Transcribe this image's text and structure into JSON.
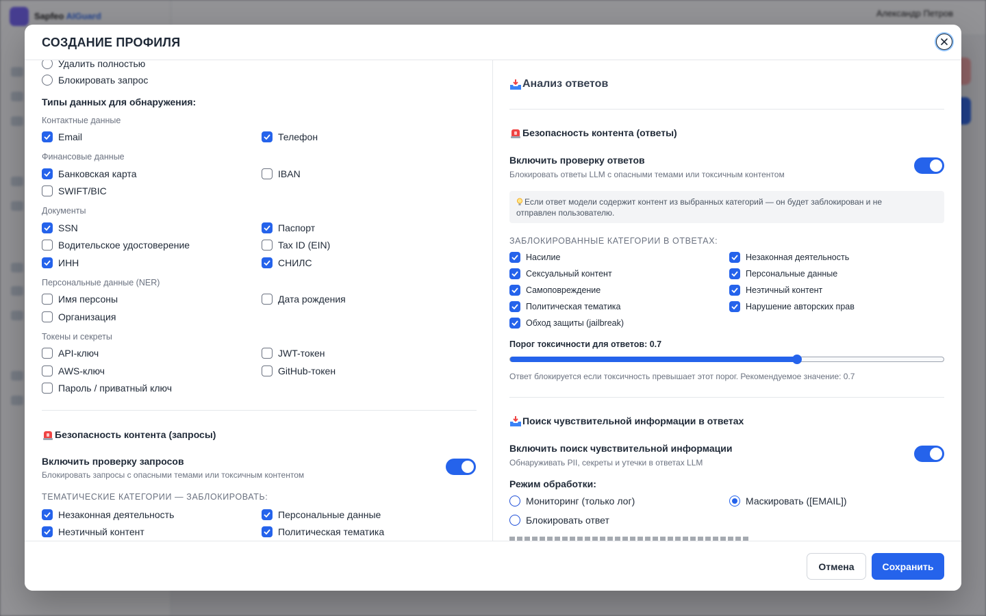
{
  "background": {
    "brand_left": "Sapfeo",
    "brand_right": "AIGuard",
    "user_name": "Александр Петров"
  },
  "modal": {
    "title": "СОЗДАНИЕ ПРОФИЛЯ",
    "close_icon": "close-icon",
    "cancel_label": "Отмена",
    "save_label": "Сохранить"
  },
  "left": {
    "action_options": [
      {
        "label": "Удалить полностью",
        "selected": false
      },
      {
        "label": "Блокировать запрос",
        "selected": false
      }
    ],
    "detect_types_title": "Типы данных для обнаружения:",
    "groups": {
      "contacts": {
        "label": "Контактные данные",
        "items": [
          {
            "label": "Email",
            "checked": true
          },
          {
            "label": "Телефон",
            "checked": true
          }
        ]
      },
      "financial": {
        "label": "Финансовые данные",
        "items": [
          {
            "label": "Банковская карта",
            "checked": true
          },
          {
            "label": "IBAN",
            "checked": false
          },
          {
            "label": "SWIFT/BIC",
            "checked": false
          }
        ]
      },
      "documents": {
        "label": "Документы",
        "items": [
          {
            "label": "SSN",
            "checked": true
          },
          {
            "label": "Паспорт",
            "checked": true
          },
          {
            "label": "Водительское удостоверение",
            "checked": false
          },
          {
            "label": "Tax ID (EIN)",
            "checked": false
          },
          {
            "label": "ИНН",
            "checked": true
          },
          {
            "label": "СНИЛС",
            "checked": true
          }
        ]
      },
      "ner": {
        "label": "Персональные данные (NER)",
        "items": [
          {
            "label": "Имя персоны",
            "checked": false
          },
          {
            "label": "Дата рождения",
            "checked": false
          },
          {
            "label": "Организация",
            "checked": false
          }
        ]
      },
      "tokens": {
        "label": "Токены и секреты",
        "items": [
          {
            "label": "API-ключ",
            "checked": false
          },
          {
            "label": "JWT-токен",
            "checked": false
          },
          {
            "label": "AWS-ключ",
            "checked": false
          },
          {
            "label": "GitHub-токен",
            "checked": false
          },
          {
            "label": "Пароль / приватный ключ",
            "checked": false
          }
        ]
      }
    },
    "content_safety": {
      "title": "Безопасность контента (запросы)",
      "toggle_label": "Включить проверку запросов",
      "toggle_desc": "Блокировать запросы с опасными темами или токсичным контентом",
      "toggle_on": true,
      "categories_label": "ТЕМАТИЧЕСКИЕ КАТЕГОРИИ — ЗАБЛОКИРОВАТЬ:",
      "categories": [
        {
          "label": "Незаконная деятельность",
          "checked": true
        },
        {
          "label": "Персональные данные",
          "checked": true
        },
        {
          "label": "Неэтичный контент",
          "checked": true
        },
        {
          "label": "Политическая тематика",
          "checked": true
        }
      ]
    }
  },
  "right": {
    "analysis_title": "Анализ ответов",
    "content_safety": {
      "title": "Безопасность контента (ответы)",
      "toggle_label": "Включить проверку ответов",
      "toggle_desc": "Блокировать ответы LLM с опасными темами или токсичным контентом",
      "toggle_on": true,
      "hint_line1": "Если ответ модели содержит контент из выбранных категорий — он будет заблокирован и не",
      "hint_line2": "отправлен пользователю.",
      "blocked_label": "ЗАБЛОКИРОВАННЫЕ КАТЕГОРИИ В ОТВЕТАХ:",
      "categories": [
        {
          "label": "Насилие",
          "checked": true
        },
        {
          "label": "Незаконная деятельность",
          "checked": true
        },
        {
          "label": "Сексуальный контент",
          "checked": true
        },
        {
          "label": "Персональные данные",
          "checked": true
        },
        {
          "label": "Самоповреждение",
          "checked": true
        },
        {
          "label": "Неэтичный контент",
          "checked": true
        },
        {
          "label": "Политическая тематика",
          "checked": true
        },
        {
          "label": "Нарушение авторских прав",
          "checked": true
        },
        {
          "label": "Обход защиты (jailbreak)",
          "checked": true
        }
      ],
      "threshold_label": "Порог токсичности для ответов:",
      "threshold_value": "0.7",
      "threshold_fraction": 0.662,
      "threshold_help": "Ответ блокируется если токсичность превышает этот порог. Рекомендуемое значение: 0.7"
    },
    "sensitive": {
      "title": "Поиск чувствительной информации в ответах",
      "toggle_label": "Включить поиск чувствительной информации",
      "toggle_desc": "Обнаруживать PII, секреты и утечки в ответах LLM",
      "toggle_on": true,
      "mode_label": "Режим обработки:",
      "modes": [
        {
          "label": "Мониторинг (только лог)",
          "selected": false
        },
        {
          "label": "Маскировать ([EMAIL])",
          "selected": true
        },
        {
          "label": "Блокировать ответ",
          "selected": false
        }
      ]
    }
  }
}
